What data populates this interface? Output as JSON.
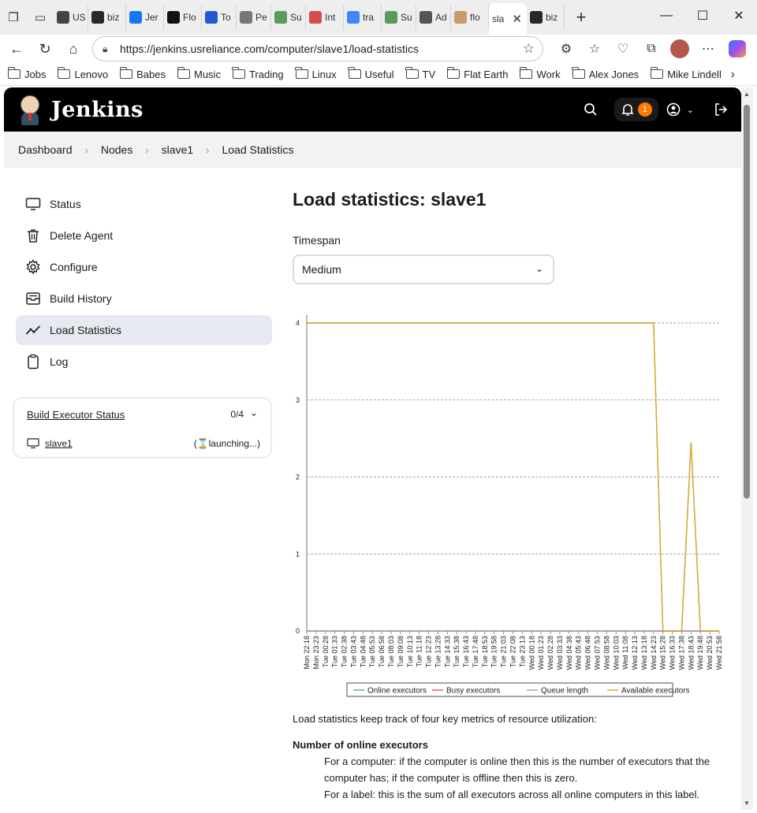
{
  "browser": {
    "tabs": [
      {
        "label": "US",
        "icon": "us-favicon",
        "color": "#444444"
      },
      {
        "label": "biz",
        "icon": "github-icon",
        "color": "#24292e"
      },
      {
        "label": "Jer",
        "icon": "facebook-icon",
        "color": "#1877f2"
      },
      {
        "label": "Flo",
        "icon": "openai-icon",
        "color": "#111111"
      },
      {
        "label": "To",
        "icon": "bluetooth-icon",
        "color": "#1f5ad3"
      },
      {
        "label": "Pe",
        "icon": "github-icon",
        "color": "#777777"
      },
      {
        "label": "Su",
        "icon": "sourcetree-icon",
        "color": "#5c9a5a"
      },
      {
        "label": "Int",
        "icon": "red-d-icon",
        "color": "#d64b4b"
      },
      {
        "label": "tra",
        "icon": "google-icon",
        "color": "#4285f4"
      },
      {
        "label": "Su",
        "icon": "sourcetree-icon",
        "color": "#5c9a5a"
      },
      {
        "label": "Ad",
        "icon": "dev-icon",
        "color": "#555555"
      },
      {
        "label": "flo",
        "icon": "jenkins-icon",
        "color": "#c99a6b"
      },
      {
        "label": "sla",
        "icon": "",
        "color": "#ffffff"
      },
      {
        "label": "biz",
        "icon": "github-icon",
        "color": "#24292e"
      }
    ],
    "url": "https://jenkins.usreliance.com/computer/slave1/load-statistics",
    "bookmarks": [
      "Jobs",
      "Lenovo",
      "Babes",
      "Music",
      "Trading",
      "Linux",
      "Useful",
      "TV",
      "Flat Earth",
      "Work",
      "Alex Jones",
      "Mike Lindell"
    ]
  },
  "header": {
    "title": "Jenkins",
    "notification_count": "1"
  },
  "breadcrumb": [
    "Dashboard",
    "Nodes",
    "slave1",
    "Load Statistics"
  ],
  "sidebar": {
    "items": [
      {
        "label": "Status",
        "icon": "monitor-icon"
      },
      {
        "label": "Delete Agent",
        "icon": "trash-icon"
      },
      {
        "label": "Configure",
        "icon": "gear-icon"
      },
      {
        "label": "Build History",
        "icon": "inbox-icon"
      },
      {
        "label": "Load Statistics",
        "icon": "trend-line-icon",
        "active": true
      },
      {
        "label": "Log",
        "icon": "clipboard-icon"
      }
    ],
    "executor_status": {
      "title": "Build Executor Status",
      "count": "0/4",
      "node": "slave1",
      "state": "(⌛launching...)"
    }
  },
  "main": {
    "title": "Load statistics: slave1",
    "timespan_label": "Timespan",
    "timespan_value": "Medium",
    "description": {
      "intro": "Load statistics keep track of four key metrics of resource utilization:",
      "heading": "Number of online executors",
      "line1": "For a computer: if the computer is online then this is the number of executors that the computer has; if the computer is offline then this is zero.",
      "line2": "For a label: this is the sum of all executors across all online computers in this label."
    }
  },
  "chart_data": {
    "type": "line",
    "ylim": [
      0,
      4
    ],
    "yticks": [
      0,
      1,
      2,
      3,
      4
    ],
    "x": [
      "Mon 22:18",
      "Mon 23:23",
      "Tue 00:28",
      "Tue 01:33",
      "Tue 02:38",
      "Tue 03:43",
      "Tue 04:48",
      "Tue 05:53",
      "Tue 06:58",
      "Tue 08:03",
      "Tue 09:08",
      "Tue 10:13",
      "Tue 11:18",
      "Tue 12:23",
      "Tue 13:28",
      "Tue 14:33",
      "Tue 15:38",
      "Tue 16:43",
      "Tue 17:48",
      "Tue 18:53",
      "Tue 19:58",
      "Tue 21:03",
      "Tue 22:08",
      "Tue 23:13",
      "Wed 00:18",
      "Wed 01:23",
      "Wed 02:28",
      "Wed 03:33",
      "Wed 04:38",
      "Wed 05:43",
      "Wed 06:48",
      "Wed 07:53",
      "Wed 08:58",
      "Wed 10:03",
      "Wed 11:08",
      "Wed 12:13",
      "Wed 13:18",
      "Wed 14:23",
      "Wed 15:28",
      "Wed 16:33",
      "Wed 17:38",
      "Wed 18:43",
      "Wed 19:48",
      "Wed 20:53",
      "Wed 21:58"
    ],
    "series": [
      {
        "name": "Online executors",
        "color": "#5aa9a0",
        "values": [
          4,
          4,
          4,
          4,
          4,
          4,
          4,
          4,
          4,
          4,
          4,
          4,
          4,
          4,
          4,
          4,
          4,
          4,
          4,
          4,
          4,
          4,
          4,
          4,
          4,
          4,
          4,
          4,
          4,
          4,
          4,
          4,
          4,
          4,
          4,
          4,
          4,
          4,
          0,
          0,
          0,
          2.45,
          0,
          0,
          0
        ]
      },
      {
        "name": "Busy executors",
        "color": "#d9534f",
        "values": [
          0,
          0,
          0,
          0,
          0,
          0,
          0,
          0,
          0,
          0,
          0,
          0,
          0,
          0,
          0,
          0,
          0,
          0,
          0,
          0,
          0,
          0,
          0,
          0,
          0,
          0,
          0,
          0,
          0,
          0,
          0,
          0,
          0,
          0,
          0,
          0,
          0,
          0,
          0,
          0,
          0,
          0,
          0,
          0,
          0
        ]
      },
      {
        "name": "Queue length",
        "color": "#9e9e9e",
        "values": [
          0,
          0,
          0,
          0,
          0,
          0,
          0,
          0,
          0,
          0,
          0,
          0,
          0,
          0,
          0,
          0,
          0,
          0,
          0,
          0,
          0,
          0,
          0,
          0,
          0,
          0,
          0,
          0,
          0,
          0,
          0,
          0,
          0,
          0,
          0,
          0,
          0,
          0,
          0,
          0,
          0,
          0,
          0,
          0,
          0
        ]
      },
      {
        "name": "Available executors",
        "color": "#e0a92c",
        "values": [
          4,
          4,
          4,
          4,
          4,
          4,
          4,
          4,
          4,
          4,
          4,
          4,
          4,
          4,
          4,
          4,
          4,
          4,
          4,
          4,
          4,
          4,
          4,
          4,
          4,
          4,
          4,
          4,
          4,
          4,
          4,
          4,
          4,
          4,
          4,
          4,
          4,
          4,
          0,
          0,
          0,
          2.45,
          0,
          0,
          0
        ]
      }
    ],
    "grid": true,
    "legend": "bottom"
  }
}
